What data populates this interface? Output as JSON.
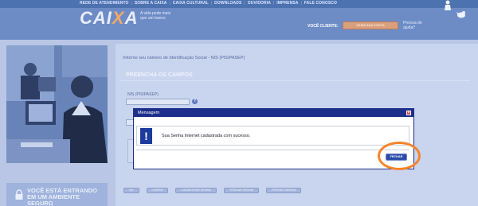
{
  "top_nav": {
    "links": [
      "REDE DE ATENDIMENTO",
      "SOBRE A CAIXA",
      "CAIXA CULTURAL",
      "DOWNLOADS",
      "OUVIDORIA",
      "IMPRENSA",
      "FALE CONOSCO"
    ]
  },
  "header": {
    "logo_prefix": "CAI",
    "logo_x": "X",
    "logo_suffix": "A",
    "tagline": "A vida pede mais que um banco",
    "welcome_label": "VOCÊ CLIENTE:",
    "welcome_button": "SAIBA SUA CONTA",
    "help_text": "Precisa de ajuda?"
  },
  "secure_banner": {
    "text": "VOCÊ ESTÁ ENTRANDO EM UM AMBIENTE SEGURO"
  },
  "form": {
    "hint": "Informe seu número de Identificação Social - NIS (PIS/PASEP)",
    "section_title": "PREENCHA OS CAMPOS",
    "nis_label": "NIS (PIS/PASEP)",
    "help_glyph": "?",
    "buttons": [
      "OK",
      "LIMPAR",
      "CADASTRAR SENHA",
      "TROCAR SENHA",
      "PERDEU SENHA"
    ]
  },
  "dialog": {
    "title": "Mensagem",
    "close_glyph": "×",
    "warn_glyph": "!",
    "message": "Sua Senha Internet cadastrada com sucesso.",
    "close_button": "FECHAR"
  },
  "colors": {
    "title_bar": "#1d2f8a",
    "highlight": "#f5842b",
    "logo_accent": "#f3a86b"
  }
}
